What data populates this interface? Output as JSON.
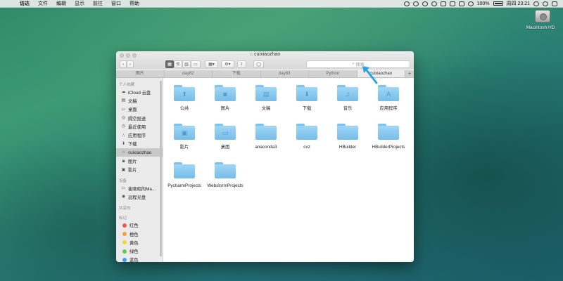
{
  "menubar": {
    "apple": "",
    "items": [
      "访达",
      "文件",
      "编辑",
      "显示",
      "前往",
      "窗口",
      "帮助"
    ],
    "battery": "100%",
    "clock": "周四 23:21"
  },
  "desktop": {
    "icon_label": "Macintosh HD"
  },
  "window": {
    "title": "cuixiaozhao",
    "search_placeholder": "搜索",
    "tabs": [
      "图片",
      "day82",
      "下载",
      "day83",
      "Python",
      "cuixiaozhao"
    ],
    "active_tab_index": 5,
    "add_tab": "+",
    "sidebar": {
      "sections": [
        {
          "title": "个人收藏",
          "items": [
            {
              "label": "iCloud 云盘",
              "icon": "cloud-icon"
            },
            {
              "label": "文稿",
              "icon": "document-icon"
            },
            {
              "label": "桌面",
              "icon": "desktop-icon"
            },
            {
              "label": "隔空投送",
              "icon": "airdrop-icon"
            },
            {
              "label": "最近使用",
              "icon": "clock-icon"
            },
            {
              "label": "应用程序",
              "icon": "apps-icon"
            },
            {
              "label": "下载",
              "icon": "download-icon"
            },
            {
              "label": "cuixiaozhao",
              "icon": "home-icon",
              "selected": true
            },
            {
              "label": "图片",
              "icon": "camera-icon"
            },
            {
              "label": "影片",
              "icon": "film-icon"
            }
          ]
        },
        {
          "title": "设备",
          "items": [
            {
              "label": "崔晓昭的Ma...",
              "icon": "laptop-icon"
            },
            {
              "label": "远程光盘",
              "icon": "disc-icon"
            }
          ]
        },
        {
          "title": "共享的",
          "items": []
        },
        {
          "title": "标记",
          "items": [
            {
              "label": "红色",
              "color": "#f0584a"
            },
            {
              "label": "橙色",
              "color": "#f5a133"
            },
            {
              "label": "黄色",
              "color": "#f5d63c"
            },
            {
              "label": "绿色",
              "color": "#5fcf4a"
            },
            {
              "label": "蓝色",
              "color": "#3e9cf3"
            }
          ]
        }
      ]
    },
    "files": [
      {
        "name": "公共",
        "icon": "public-folder-icon"
      },
      {
        "name": "图片",
        "icon": "pictures-folder-icon"
      },
      {
        "name": "文稿",
        "icon": "documents-folder-icon"
      },
      {
        "name": "下载",
        "icon": "downloads-folder-icon"
      },
      {
        "name": "音乐",
        "icon": "music-folder-icon"
      },
      {
        "name": "应用程序",
        "icon": "applications-folder-icon"
      },
      {
        "name": "影片",
        "icon": "movies-folder-icon"
      },
      {
        "name": "桌面",
        "icon": "desktop-folder-icon"
      },
      {
        "name": "anaconda3",
        "icon": "folder-icon"
      },
      {
        "name": "cxz",
        "icon": "folder-icon"
      },
      {
        "name": "HBuilder",
        "icon": "folder-icon"
      },
      {
        "name": "HBuilderProjects",
        "icon": "folder-icon"
      },
      {
        "name": "PycharmProjects",
        "icon": "folder-icon"
      },
      {
        "name": "WebstormProjects",
        "icon": "folder-icon"
      }
    ]
  },
  "colors": {
    "folder": "#8ccbf1",
    "arrow": "#2fa2e0"
  }
}
